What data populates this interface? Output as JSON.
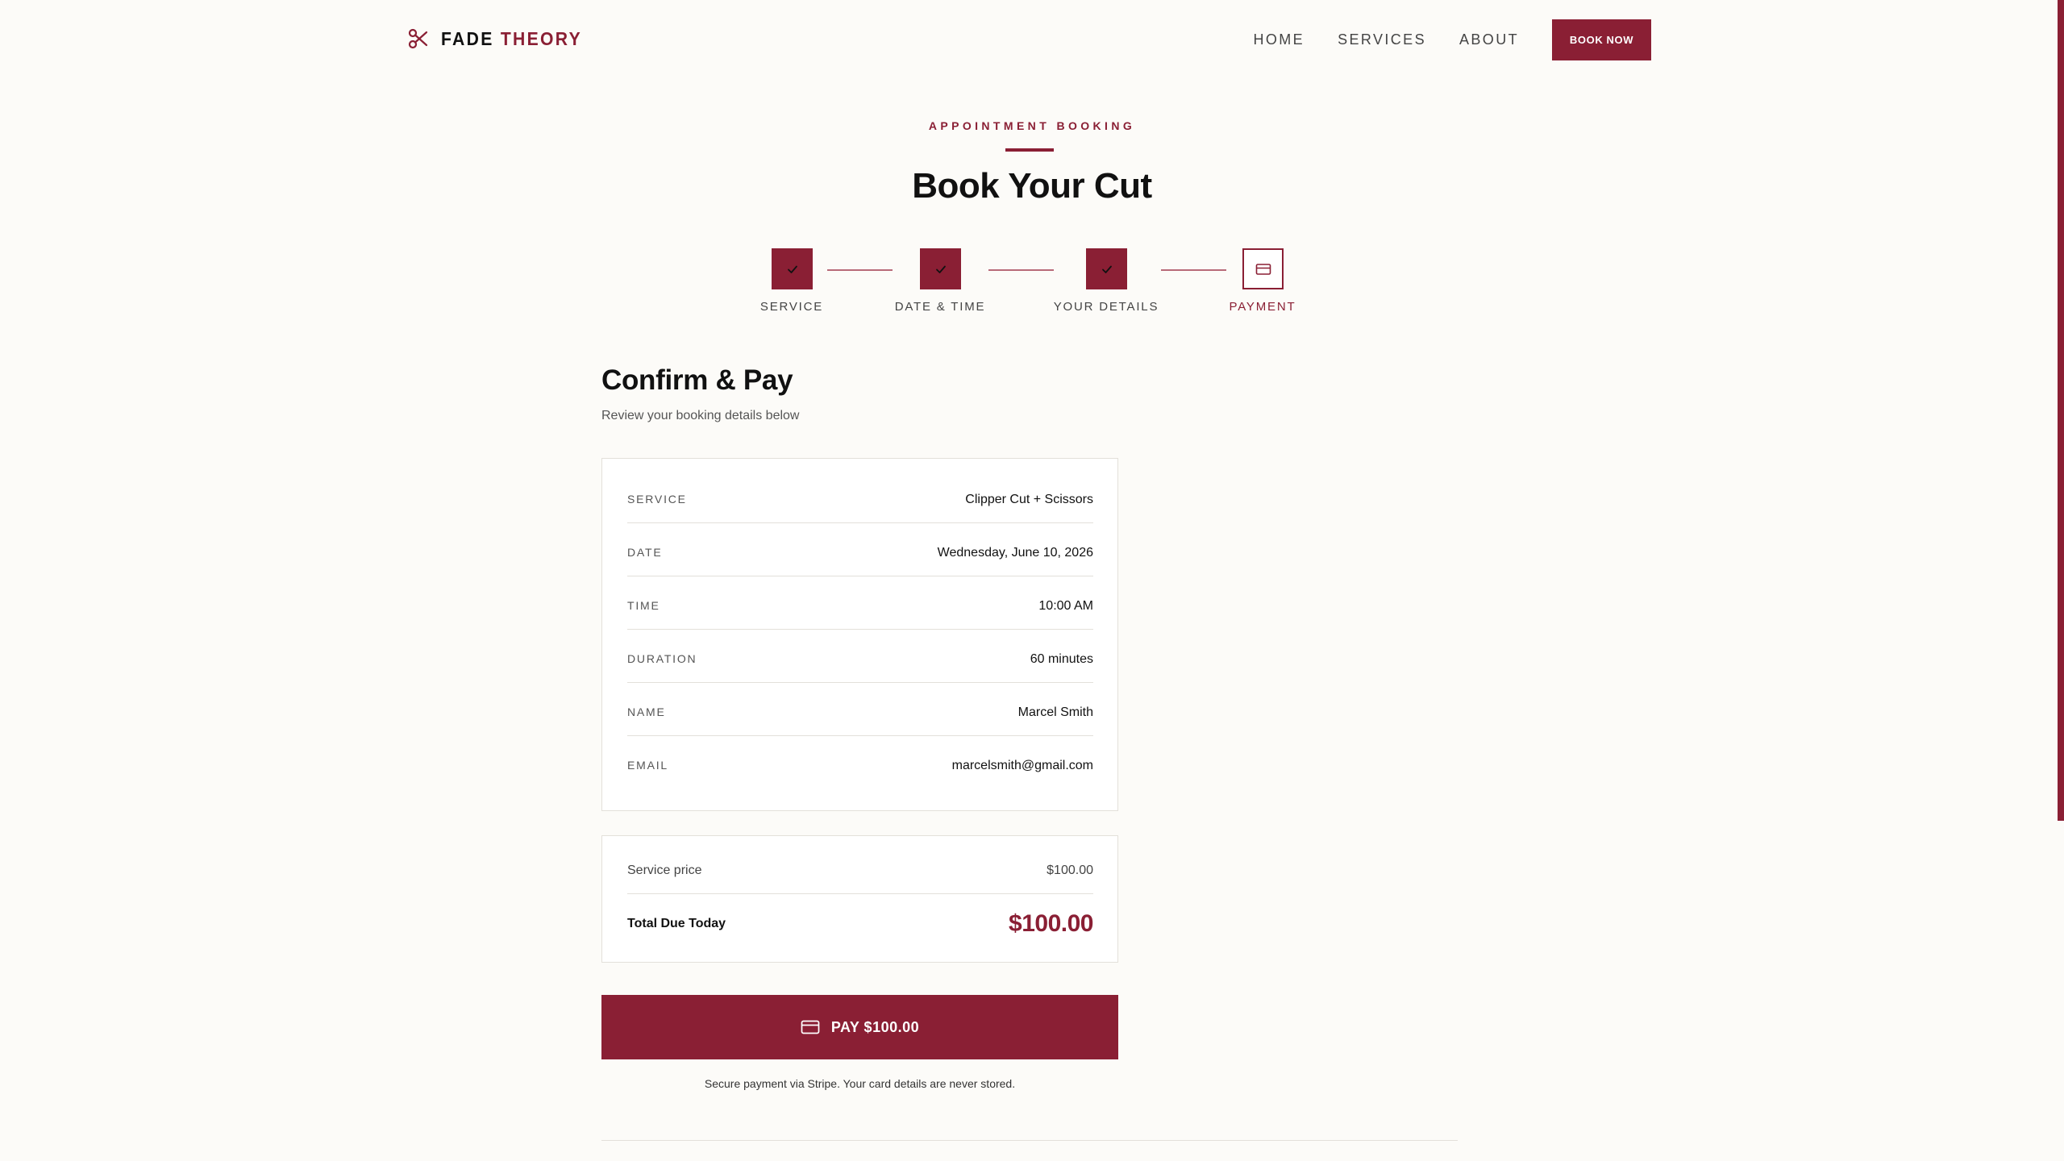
{
  "header": {
    "brand_first": "FADE",
    "brand_second": "THEORY",
    "brand_icon": "scissors-icon",
    "nav": {
      "home": "HOME",
      "services": "SERVICES",
      "about": "ABOUT",
      "book_now": "BOOK NOW"
    }
  },
  "hero": {
    "eyebrow": "APPOINTMENT BOOKING",
    "title": "Book Your Cut"
  },
  "stepper": {
    "steps": [
      {
        "label": "SERVICE",
        "status": "complete",
        "icon": "check-icon"
      },
      {
        "label": "DATE & TIME",
        "status": "complete",
        "icon": "check-icon"
      },
      {
        "label": "YOUR DETAILS",
        "status": "complete",
        "icon": "check-icon"
      },
      {
        "label": "PAYMENT",
        "status": "current",
        "icon": "credit-card-icon"
      }
    ]
  },
  "confirm": {
    "title": "Confirm & Pay",
    "subtitle": "Review your booking details below",
    "details": [
      {
        "label": "SERVICE",
        "value": "Clipper Cut + Scissors"
      },
      {
        "label": "DATE",
        "value": "Wednesday, June 10, 2026"
      },
      {
        "label": "TIME",
        "value": "10:00 AM"
      },
      {
        "label": "DURATION",
        "value": "60 minutes"
      },
      {
        "label": "NAME",
        "value": "Marcel Smith"
      },
      {
        "label": "EMAIL",
        "value": "marcelsmith@gmail.com"
      }
    ],
    "pricing": {
      "service_price_label": "Service price",
      "service_price_value": "$100.00",
      "total_label": "Total Due Today",
      "total_value": "$100.00"
    },
    "pay_button": {
      "label": "PAY $100.00",
      "icon": "credit-card-icon"
    },
    "secure_note": "Secure payment via Stripe. Your card details are never stored."
  },
  "theme": {
    "accent": "#8a1f34",
    "background": "#fcfbf8",
    "border": "#e3e0da"
  }
}
